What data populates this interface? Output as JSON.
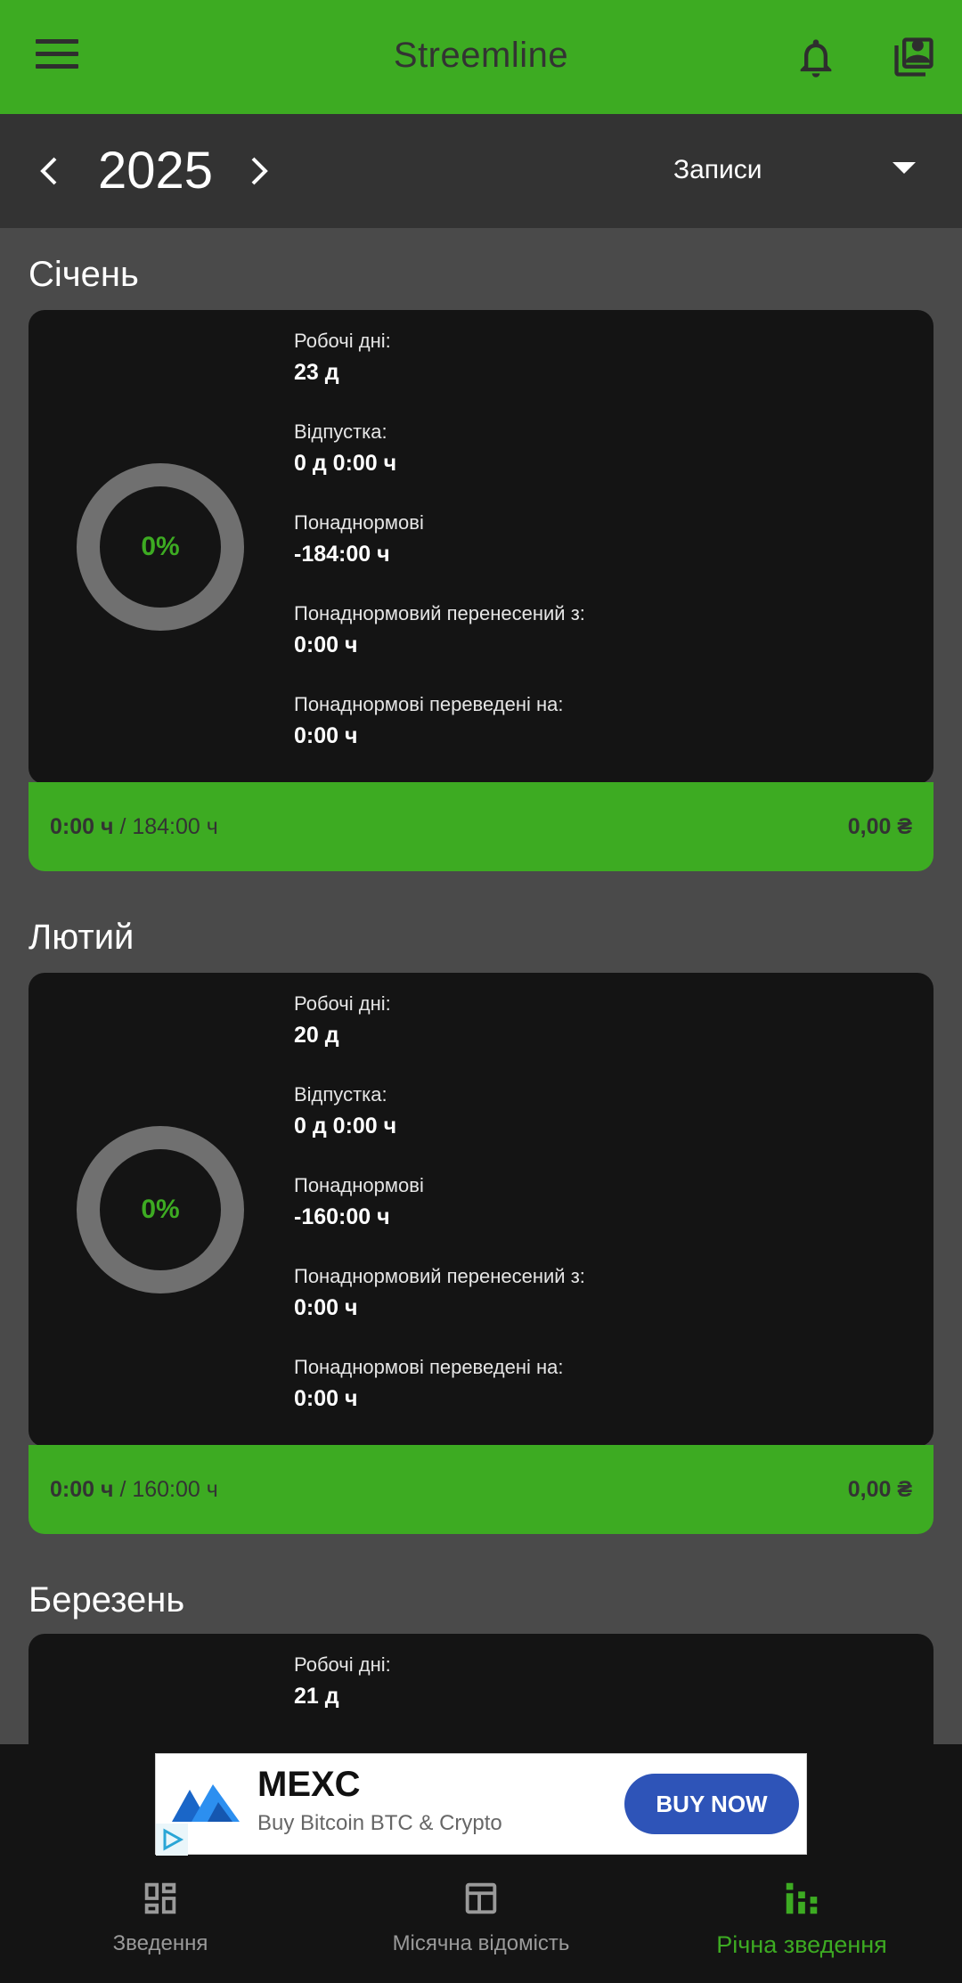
{
  "appbar": {
    "title": "Streemline",
    "icons": [
      "menu-icon",
      "bell-icon",
      "profile-icon"
    ]
  },
  "yearbar": {
    "year": "2025",
    "filter_selected": "Записи"
  },
  "colors": {
    "accent": "#3dab22",
    "card": "#141414",
    "page_bg": "#4a4a4a",
    "ring": "#707070"
  },
  "months": [
    {
      "name": "Січень",
      "percent": "0%",
      "stats": [
        {
          "label": "Робочі дні:",
          "value": "23 д"
        },
        {
          "label": "Відпустка:",
          "value": "0 д 0:00 ч"
        },
        {
          "label": "Понаднормові",
          "value": "-184:00 ч"
        },
        {
          "label": "Понаднормовий перенесений з:",
          "value": "0:00 ч"
        },
        {
          "label": "Понаднормові переведені на:",
          "value": "0:00 ч"
        }
      ],
      "hours_done": "0:00 ч",
      "hours_total": "/ 184:00 ч",
      "money": "0,00 ₴"
    },
    {
      "name": "Лютий",
      "percent": "0%",
      "stats": [
        {
          "label": "Робочі дні:",
          "value": "20 д"
        },
        {
          "label": "Відпустка:",
          "value": "0 д 0:00 ч"
        },
        {
          "label": "Понаднормові",
          "value": "-160:00 ч"
        },
        {
          "label": "Понаднормовий перенесений з:",
          "value": "0:00 ч"
        },
        {
          "label": "Понаднормові переведені на:",
          "value": "0:00 ч"
        }
      ],
      "hours_done": "0:00 ч",
      "hours_total": "/ 160:00 ч",
      "money": "0,00 ₴"
    },
    {
      "name": "Березень",
      "stats": [
        {
          "label": "Робочі дні:",
          "value": "21 д"
        }
      ]
    }
  ],
  "ad": {
    "brand": "MEXC",
    "description": "Buy Bitcoin BTC & Crypto",
    "cta": "BUY NOW"
  },
  "nav": {
    "items": [
      {
        "label": "Зведення",
        "icon": "dashboard-icon"
      },
      {
        "label": "Місячна відомість",
        "icon": "table-icon"
      },
      {
        "label": "Річна зведення",
        "icon": "bar-chart-icon"
      }
    ],
    "active_index": 2
  }
}
